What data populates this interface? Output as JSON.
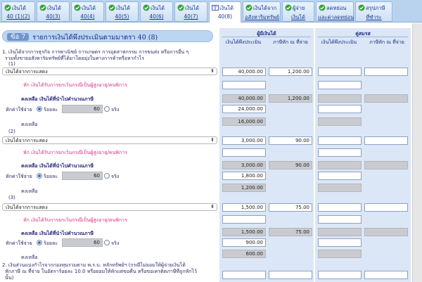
{
  "tabs": [
    {
      "l1": "เงินได้",
      "l2": "40 (1)(2)",
      "icon": "green-check-icon"
    },
    {
      "l1": "เงินได้",
      "l2": "40(3)",
      "icon": "green-check-icon"
    },
    {
      "l1": "เงินได้",
      "l2": "40(4)",
      "icon": "green-check-icon"
    },
    {
      "l1": "เงินได้",
      "l2": "40(5)",
      "icon": "green-check-icon"
    },
    {
      "l1": "เงินได้",
      "l2": "40(6)",
      "icon": "green-check-icon"
    },
    {
      "l1": "เงินได้",
      "l2": "40(7)",
      "icon": "green-check-icon"
    },
    {
      "l1": "เงินได้",
      "l2": "40(8)",
      "icon": "book-icon"
    },
    {
      "l1": "เงินได้จาก",
      "l2": "อสังหาริมทรัพย์",
      "icon": "green-check-icon"
    },
    {
      "l1": "ผู้จ่าย",
      "l2": "เงินได้",
      "icon": "green-check-icon"
    },
    {
      "l1": "ลดหย่อน",
      "l2": "และค่าลดหย่อน",
      "icon": "green-check-icon"
    },
    {
      "l1": "สรุปภาษี",
      "l2": "ที่ชำระ",
      "icon": "green-check-icon"
    }
  ],
  "section": {
    "number": "ข้อ 7",
    "title": "รายการเงินได้พึงประเมินตามมาตรา 40 (8)"
  },
  "headers": {
    "filer": "ผู้มีเงินได้",
    "spouse": "คู่สมรส",
    "col_income": "เงินได้พึงประเมิน",
    "col_tax": "ภาษีหัก ณ ที่จ่าย"
  },
  "intro": {
    "line1": "1. เงินได้จากการธุรกิจ การพาณิชย์ การเกษตร การอุตสาหกรรม การขนส่ง หรือการอื่น ๆ",
    "line2": "รวมทั้งขายอสังหาริมทรัพย์ที่ได้มาโดยมุ่งในทางการค้าหรือหากำไร"
  },
  "labels": {
    "deduct_child": "หัก  เงินได้รับการยกเว้นกรณีเป็นผู้สูงอายุ/คนพิการ",
    "remaining_calc": "คงเหลือ  เงินได้ที่นำไปคำนวณภาษี",
    "expense": "หักค่าใช้จ่าย",
    "percent": "ร้อยละ",
    "actual": "จริง",
    "balance": "คงเหลือ"
  },
  "items": [
    {
      "no": "(1)",
      "type": "เงินได้จากการแสดง",
      "income": "40,000.00",
      "tax": "1,200.00",
      "calc_income": "40,000.00",
      "calc_tax": "1,200.00",
      "pct": "60",
      "expense": "24,000.00",
      "balance": "16,000.00"
    },
    {
      "no": "(2)",
      "type": "เงินได้จากการแสดง",
      "income": "3,000.00",
      "tax": "90.00",
      "calc_income": "3,000.00",
      "calc_tax": "90.00",
      "pct": "60",
      "expense": "1,800.00",
      "balance": "1,200.00"
    },
    {
      "no": "(3)",
      "type": "เงินได้จากการแสดง",
      "income": "1,500.00",
      "tax": "75.00",
      "calc_income": "1,500.00",
      "calc_tax": "75.00",
      "pct": "60",
      "expense": "900.00",
      "balance": "600.00"
    }
  ],
  "footer": {
    "line1": "2. เงินส่วนแบ่งกำไรจากกองทุนรวมตาม พ.ร.บ. หลักทรัพย์ฯ (กรณีไม่ยอมให้ผู้จ่ายเงินได้",
    "line2": "หักภาษี ณ ที่จ่าย ในอัตราร้อยละ 10.0 หรือยอมให้หักแต่ขอคืน หรือขอเครดิตภาษีที่ถูกหักไว้",
    "line3": "นั้น)"
  }
}
